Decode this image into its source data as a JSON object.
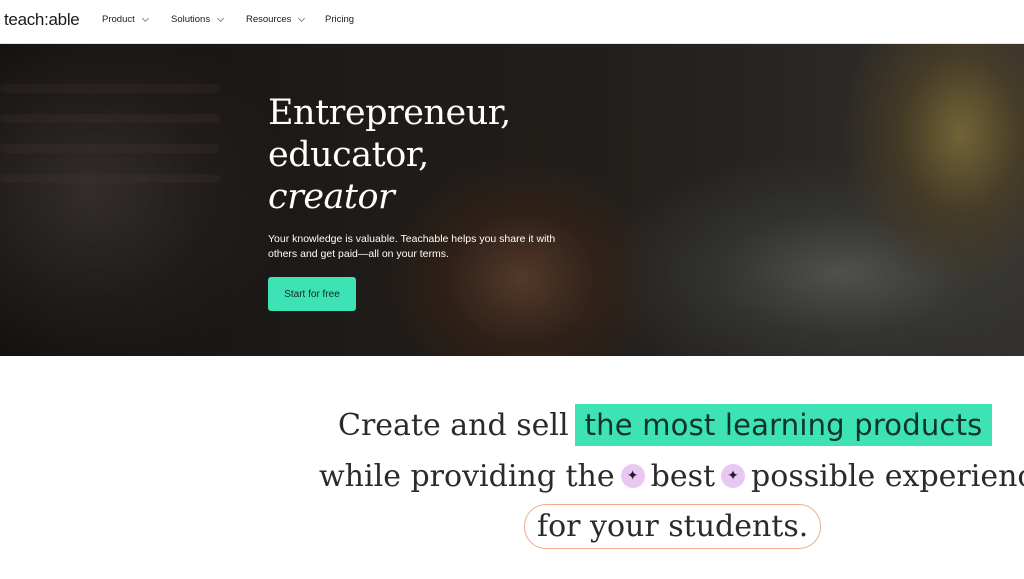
{
  "nav": {
    "logo": "teach:able",
    "items": [
      {
        "label": "Product",
        "has_dropdown": true
      },
      {
        "label": "Solutions",
        "has_dropdown": true
      },
      {
        "label": "Resources",
        "has_dropdown": true
      },
      {
        "label": "Pricing",
        "has_dropdown": false
      }
    ]
  },
  "hero": {
    "title_line1": "Entrepreneur,",
    "title_line2": "educator,",
    "title_line3": "creator",
    "subtitle": "Your knowledge is valuable. Teachable helps you share it with others and get paid—all on your terms.",
    "cta_label": "Start for free"
  },
  "tagline": {
    "part1": "Create and sell",
    "highlight": "the most learning products",
    "part2": "while providing the",
    "best": "best",
    "part3": "possible experience",
    "part4": "for your students."
  },
  "colors": {
    "accent": "#3de3b4",
    "sparkle_bg": "#e8c8f2",
    "pill_border": "#f2a98a"
  },
  "icons": {
    "sparkle": "sparkle-icon"
  }
}
